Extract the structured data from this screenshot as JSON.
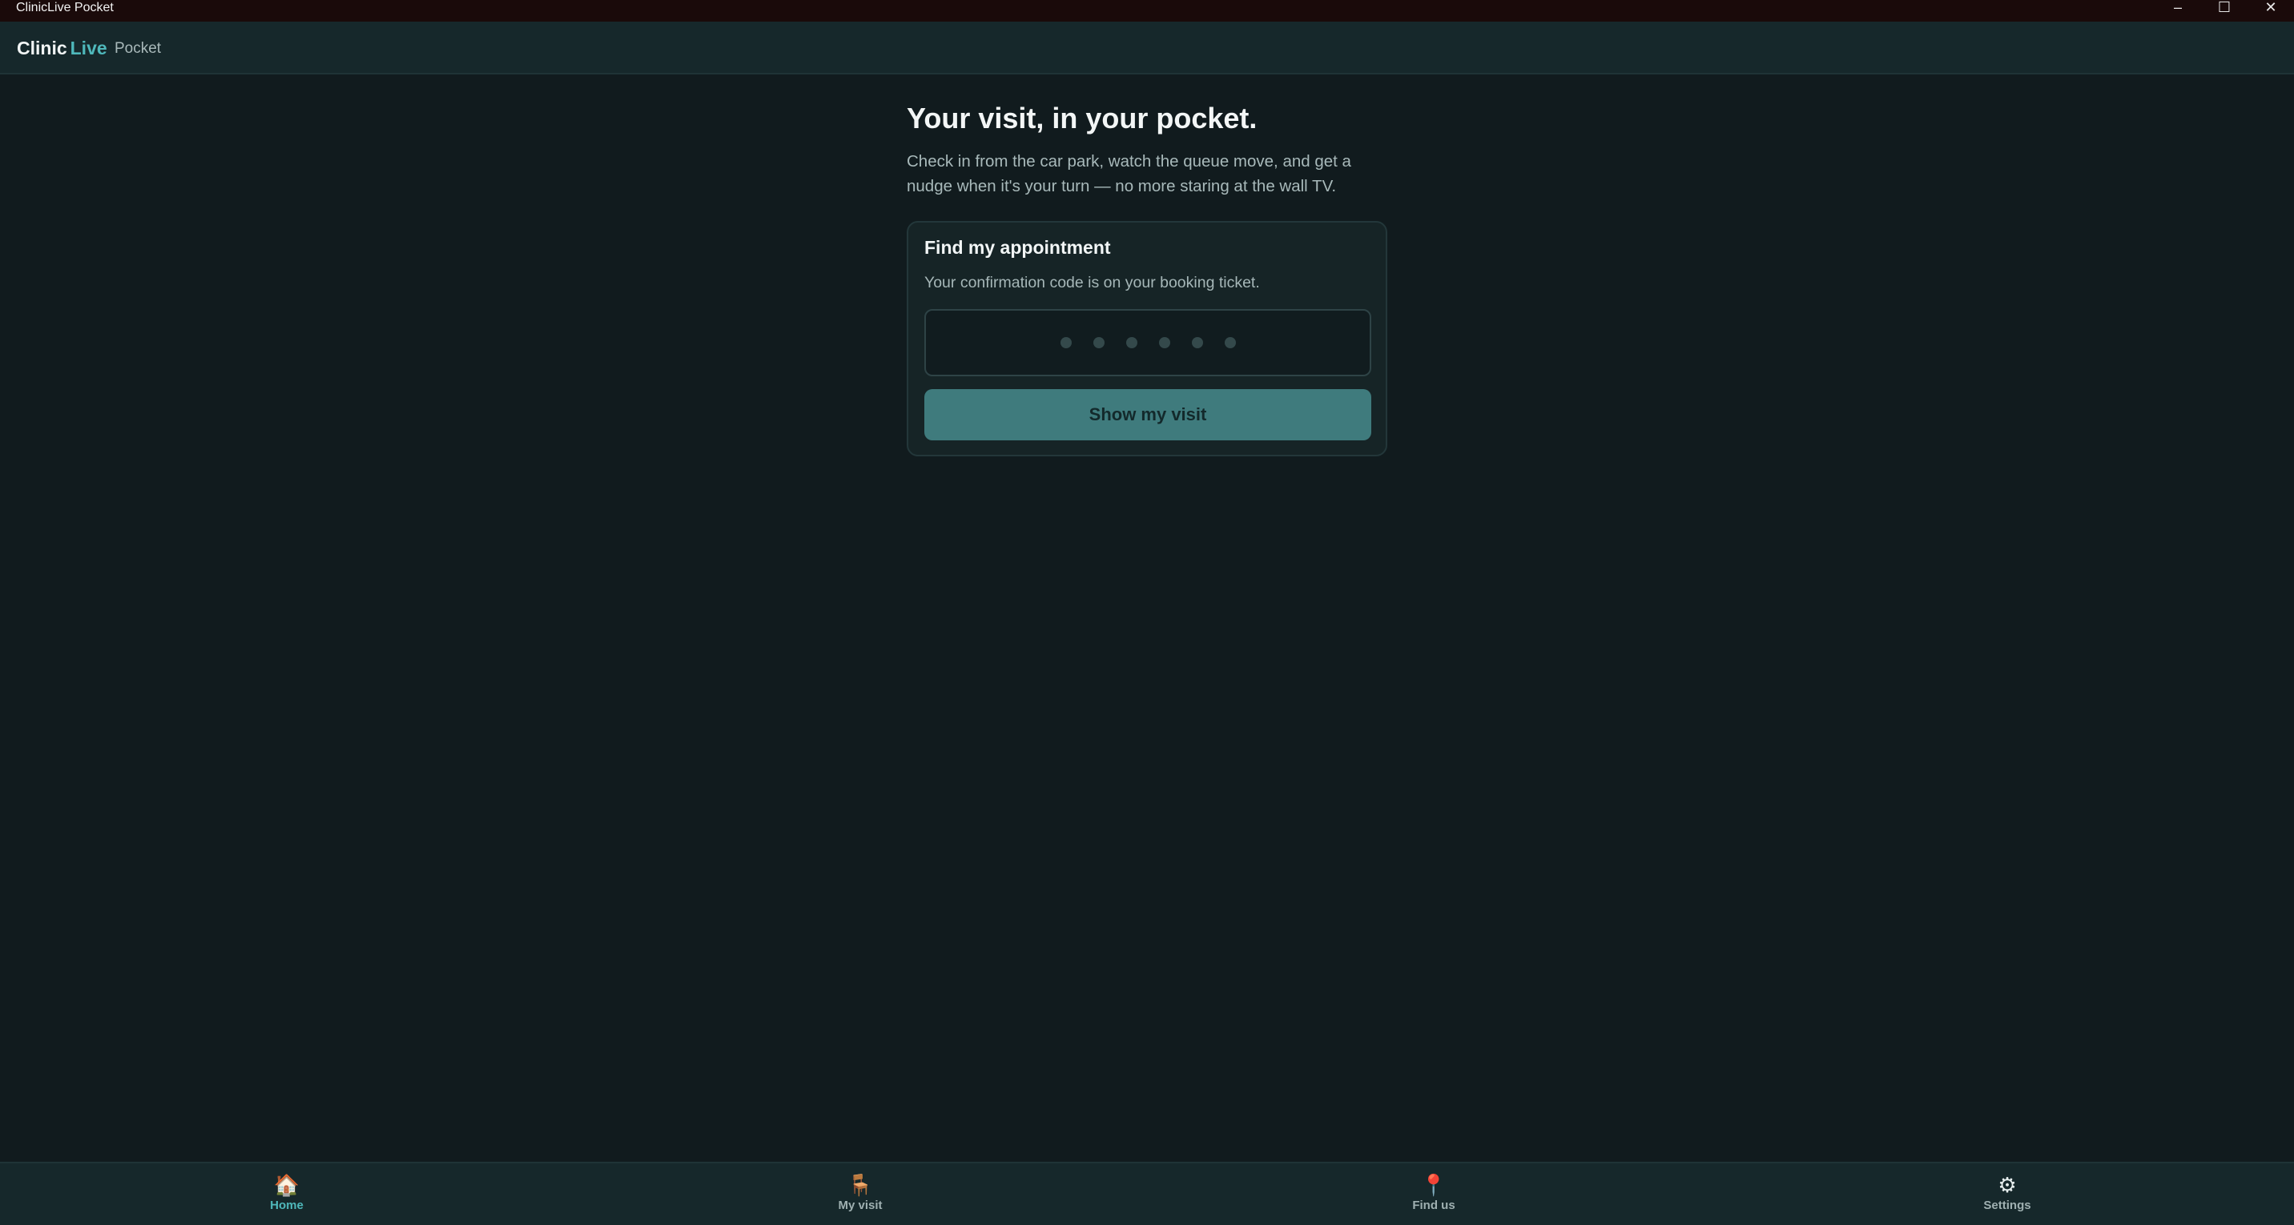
{
  "window": {
    "title": "ClinicLive Pocket",
    "minimize_glyph": "–",
    "maximize_glyph": "☐",
    "close_glyph": "✕"
  },
  "header": {
    "brand_part1": "Clinic",
    "brand_part2": "Live",
    "brand_subtitle": "Pocket"
  },
  "hero": {
    "title": "Your visit, in your pocket.",
    "text": "Check in from the car park, watch the queue move, and get a nudge when it's your turn — no more staring at the wall TV."
  },
  "appointment_card": {
    "title": "Find my appointment",
    "hint": "Your confirmation code is on your booking ticket.",
    "code_slots": 6,
    "button_label": "Show my visit"
  },
  "bottom_nav": {
    "items": [
      {
        "label": "Home",
        "icon": "house-icon",
        "glyph": "🏠",
        "active": true
      },
      {
        "label": "My visit",
        "icon": "chair-icon",
        "glyph": "🪑",
        "active": false
      },
      {
        "label": "Find us",
        "icon": "map-pin-icon",
        "glyph": "📍",
        "active": false
      },
      {
        "label": "Settings",
        "icon": "gear-icon",
        "glyph": "⚙",
        "active": false
      }
    ]
  },
  "colors": {
    "accent": "#4fb8bb",
    "button_bg": "#3f7b7d",
    "background": "#111b1e"
  }
}
